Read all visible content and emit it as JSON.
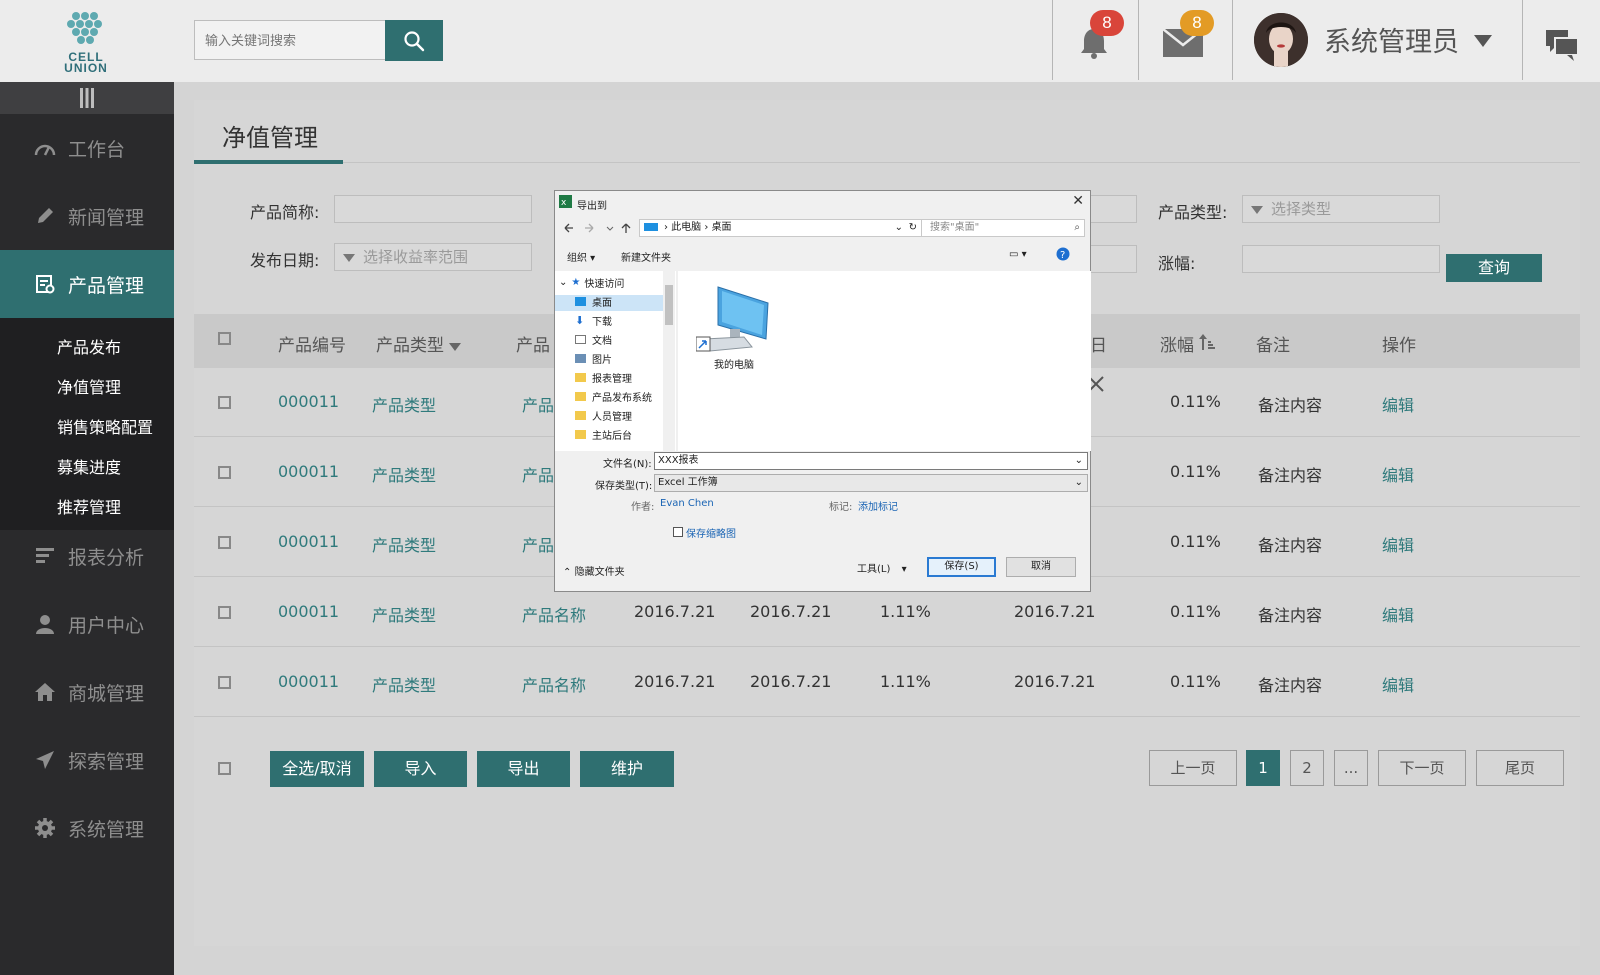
{
  "header": {
    "logo_text_line1": "CELL",
    "logo_text_line2": "UNION",
    "search_placeholder": "输入关键词搜索",
    "notifications_count": "8",
    "messages_count": "8",
    "username": "系统管理员",
    "colors": {
      "accent": "#2f6f70",
      "badge_red": "#d9453a",
      "badge_orange": "#e39b25"
    }
  },
  "sidebar": {
    "items": [
      {
        "label": "工作台",
        "icon": "dashboard-icon"
      },
      {
        "label": "新闻管理",
        "icon": "pencil-icon"
      },
      {
        "label": "产品管理",
        "icon": "product-icon",
        "active": true
      },
      {
        "label": "报表分析",
        "icon": "report-icon"
      },
      {
        "label": "用户中心",
        "icon": "user-icon"
      },
      {
        "label": "商城管理",
        "icon": "home-icon"
      },
      {
        "label": "探索管理",
        "icon": "send-icon"
      },
      {
        "label": "系统管理",
        "icon": "gear-icon"
      }
    ],
    "sub_items": [
      "产品发布",
      "净值管理",
      "销售策略配置",
      "募集进度",
      "推荐管理"
    ]
  },
  "page": {
    "title": "净值管理",
    "filters": {
      "product_short_label": "产品简称:",
      "product_type_label": "产品类型:",
      "product_type_placeholder": "选择类型",
      "publish_date_label": "发布日期:",
      "publish_date_placeholder": "选择收益率范围",
      "change_label": "涨幅:",
      "query_button": "查询"
    },
    "table": {
      "headers": [
        "产品编号",
        "产品类型",
        "产品",
        "日",
        "涨幅",
        "备注",
        "操作"
      ],
      "rows": [
        [
          "000011",
          "产品类型",
          "产品",
          "",
          "",
          "",
          "",
          "0.11%",
          "备注内容",
          "编辑"
        ],
        [
          "000011",
          "产品类型",
          "产品",
          "",
          "",
          "",
          "",
          "0.11%",
          "备注内容",
          "编辑"
        ],
        [
          "000011",
          "产品类型",
          "产品",
          "",
          "",
          "",
          "",
          "0.11%",
          "备注内容",
          "编辑"
        ],
        [
          "000011",
          "产品类型",
          "产品名称",
          "2016.7.21",
          "2016.7.21",
          "1.11%",
          "2016.7.21",
          "0.11%",
          "备注内容",
          "编辑"
        ],
        [
          "000011",
          "产品类型",
          "产品名称",
          "2016.7.21",
          "2016.7.21",
          "1.11%",
          "2016.7.21",
          "0.11%",
          "备注内容",
          "编辑"
        ]
      ]
    },
    "actions": [
      "全选/取消",
      "导入",
      "导出",
      "维护"
    ],
    "pagination": [
      "上一页",
      "1",
      "2",
      "...",
      "下一页",
      "尾页"
    ]
  },
  "dialog": {
    "title": "导出到",
    "path": [
      "此电脑",
      "桌面"
    ],
    "search_placeholder": "搜索\"桌面\"",
    "toolbar": {
      "organize": "组织",
      "new_folder": "新建文件夹"
    },
    "tree": [
      "快速访问",
      "桌面",
      "下载",
      "文档",
      "图片",
      "报表管理",
      "产品发布系统",
      "人员管理",
      "主站后台"
    ],
    "file_item": "我的电脑",
    "filename_label": "文件名(N):",
    "filename_value": "XXX报表",
    "filetype_label": "保存类型(T):",
    "filetype_value": "Excel 工作簿",
    "author_label": "作者:",
    "author_value": "Evan Chen",
    "tags_label": "标记:",
    "tags_value": "添加标记",
    "thumbnail_label": "保存缩略图",
    "hide_folders": "隐藏文件夹",
    "tools": "工具(L)",
    "save": "保存(S)",
    "cancel": "取消"
  }
}
